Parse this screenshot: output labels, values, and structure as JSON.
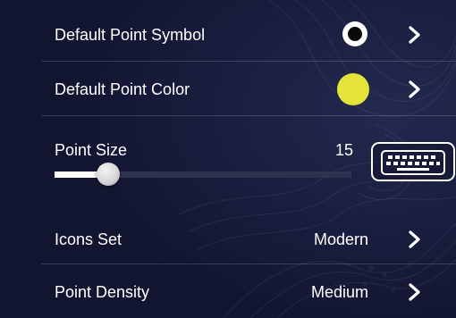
{
  "settings": {
    "default_point_symbol": {
      "label": "Default Point Symbol",
      "symbol_icon": "filled-circle-ring-icon",
      "chevron_icon": "chevron-right-icon"
    },
    "default_point_color": {
      "label": "Default Point Color",
      "swatch_color": "#e6e43a",
      "chevron_icon": "chevron-right-icon"
    },
    "point_size": {
      "label": "Point Size",
      "value": "15",
      "slider_fraction": 0.18,
      "keyboard_icon": "keyboard-icon"
    },
    "icons_set": {
      "label": "Icons Set",
      "value": "Modern",
      "chevron_icon": "chevron-right-icon"
    },
    "point_density": {
      "label": "Point Density",
      "value": "Medium",
      "chevron_icon": "chevron-right-icon"
    }
  },
  "colors": {
    "background": "#161a38",
    "accent_yellow": "#e6e43a",
    "text": "#ffffff"
  }
}
